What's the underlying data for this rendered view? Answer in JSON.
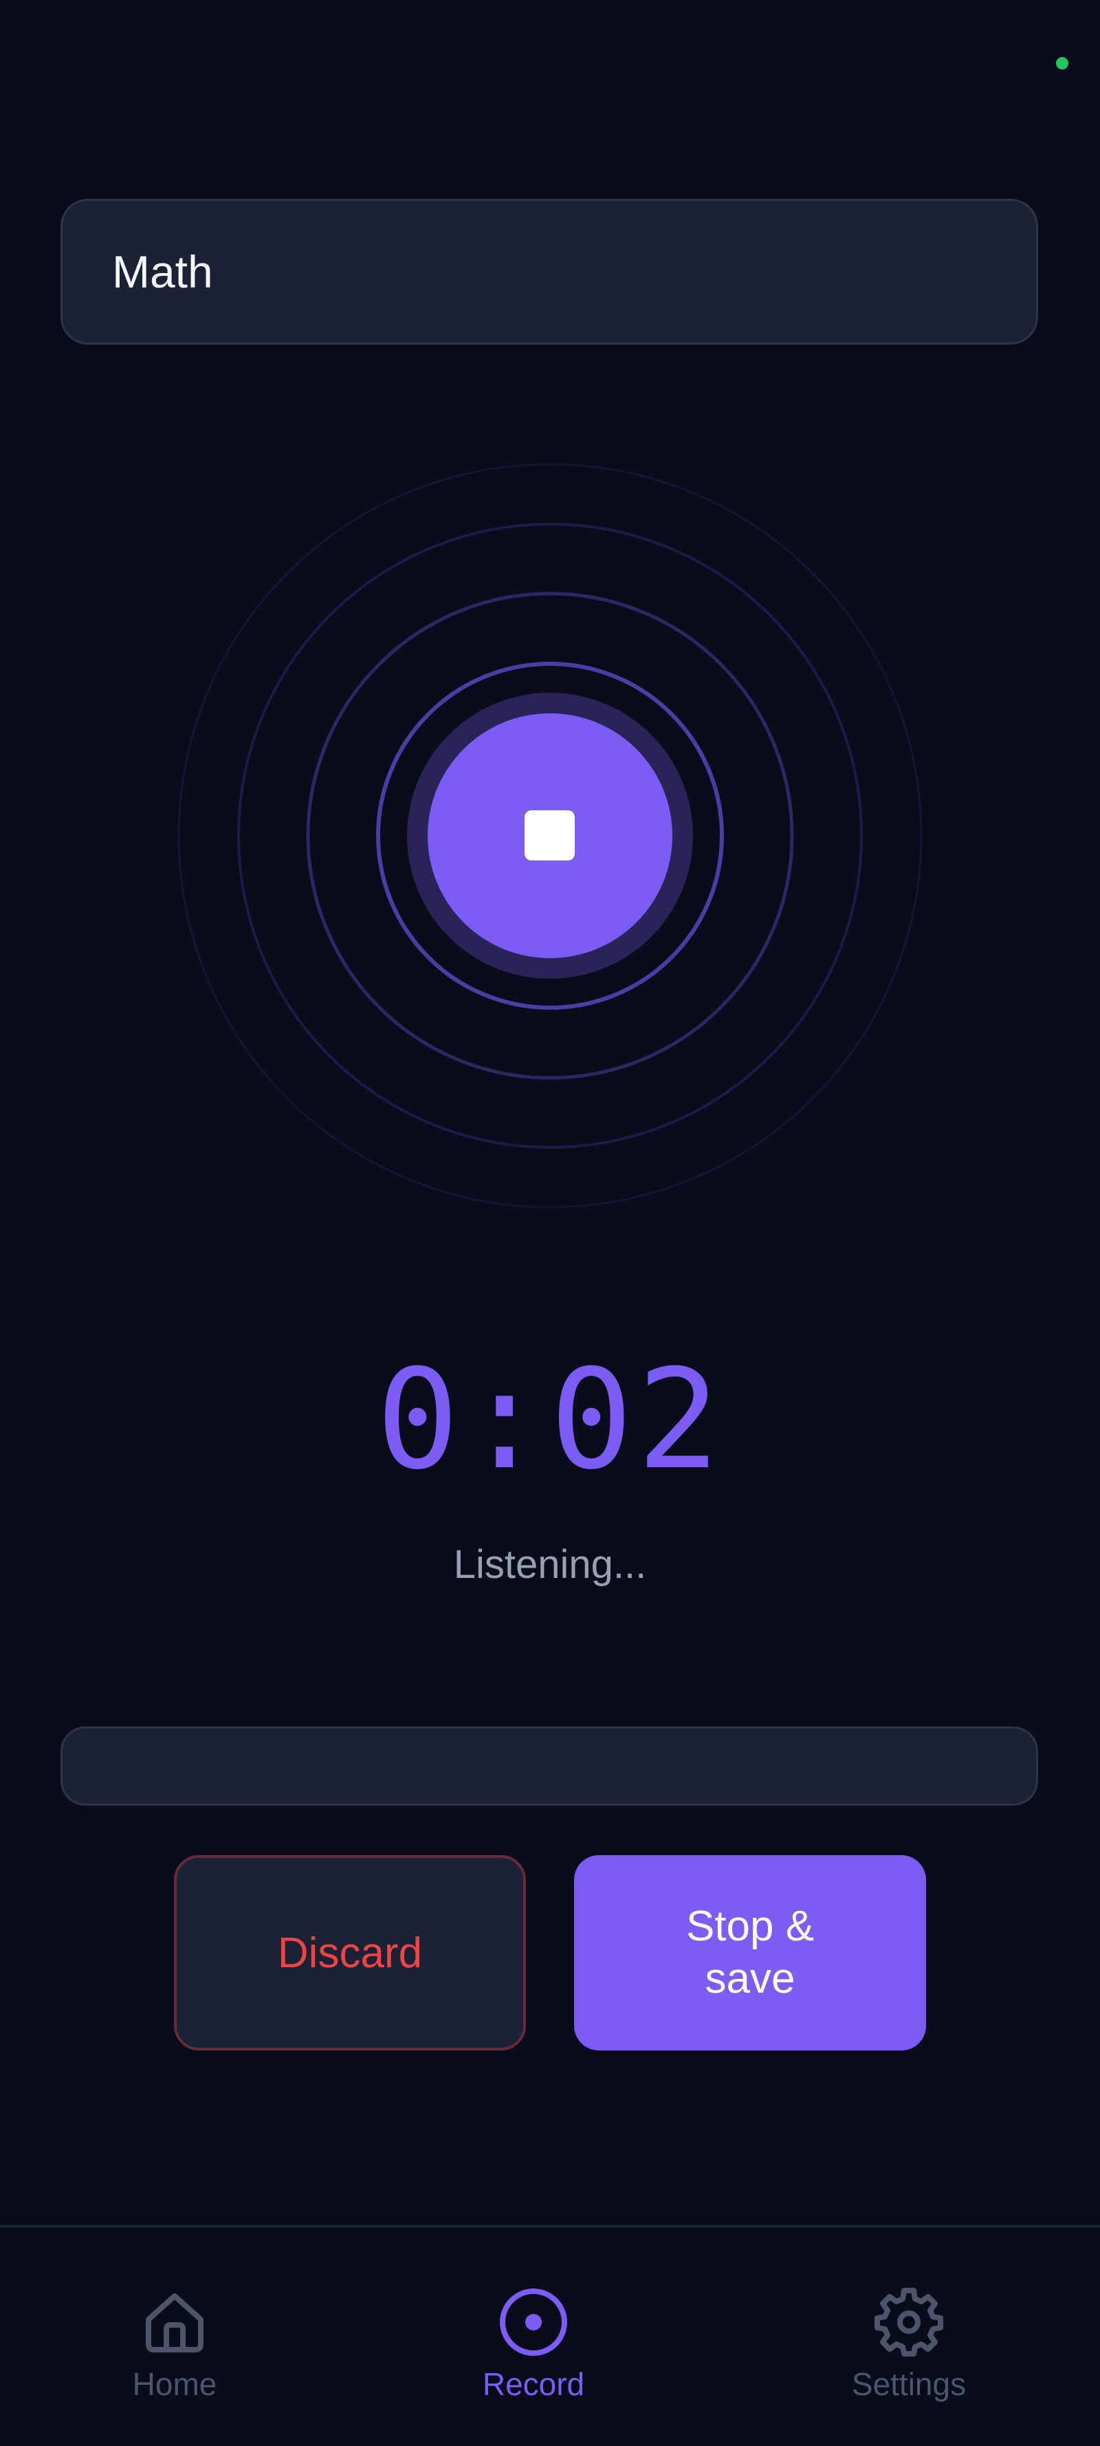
{
  "subject": {
    "value": "Math",
    "placeholder": "Subject"
  },
  "recorder": {
    "timer": "0:02",
    "status": "Listening...",
    "stop_icon": "stop-square-icon"
  },
  "transcript": {
    "text": ""
  },
  "actions": {
    "discard_label": "Discard",
    "save_label": "Stop & save"
  },
  "nav": {
    "items": [
      {
        "label": "Home",
        "icon": "home-icon",
        "active": false
      },
      {
        "label": "Record",
        "icon": "record-icon",
        "active": true
      },
      {
        "label": "Settings",
        "icon": "gear-icon",
        "active": false
      }
    ]
  },
  "colors": {
    "background": "#090c1b",
    "surface": "#1c2235",
    "accent": "#7c5cf5",
    "danger": "#ef4444",
    "online": "#22c55e",
    "muted": "#4d556b"
  }
}
